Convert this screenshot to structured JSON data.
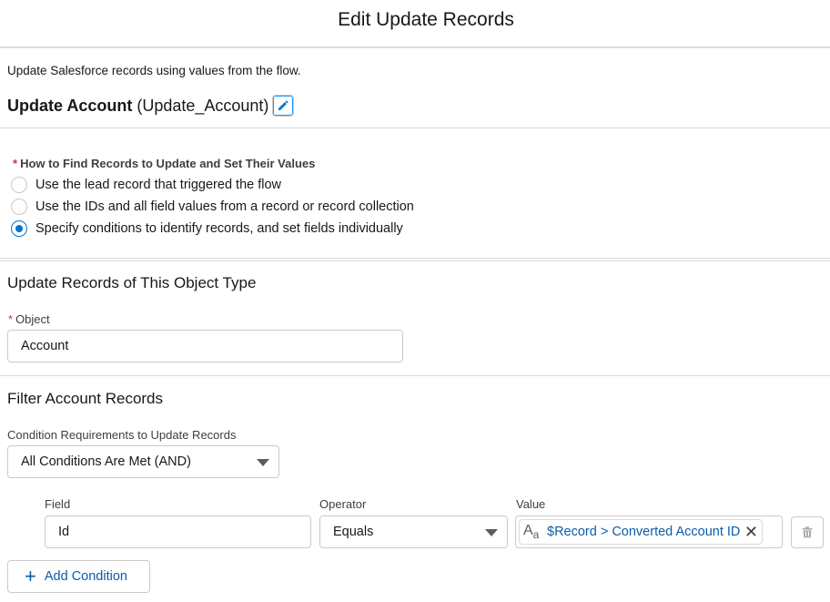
{
  "header": {
    "title": "Edit Update Records"
  },
  "element": {
    "description": "Update Salesforce records using values from the flow.",
    "label": "Update Account",
    "api_name": "(Update_Account)",
    "edit_icon": "pencil-icon"
  },
  "find_records": {
    "required_marker": "*",
    "title": "How to Find Records to Update and Set Their Values",
    "options": [
      {
        "label": "Use the lead record that triggered the flow",
        "selected": false
      },
      {
        "label": "Use the IDs and all field values from a record or record collection",
        "selected": false
      },
      {
        "label": "Specify conditions to identify records, and set fields individually",
        "selected": true
      }
    ]
  },
  "object_section": {
    "title": "Update Records of This Object Type",
    "required_marker": "*",
    "object_label": "Object",
    "object_value": "Account"
  },
  "filter_section": {
    "title": "Filter Account Records",
    "requirement_label": "Condition Requirements to Update Records",
    "requirement_value": "All Conditions Are Met (AND)",
    "columns": {
      "field": "Field",
      "operator": "Operator",
      "value": "Value"
    },
    "condition": {
      "field": "Id",
      "operator": "Equals",
      "value_icon": "text-type-icon",
      "value": "$Record > Converted Account ID"
    },
    "add_condition_label": "Add Condition"
  },
  "colors": {
    "accent": "#0176d3",
    "link": "#0b5cab",
    "border": "#c9c9c9",
    "required": "#c23934"
  }
}
